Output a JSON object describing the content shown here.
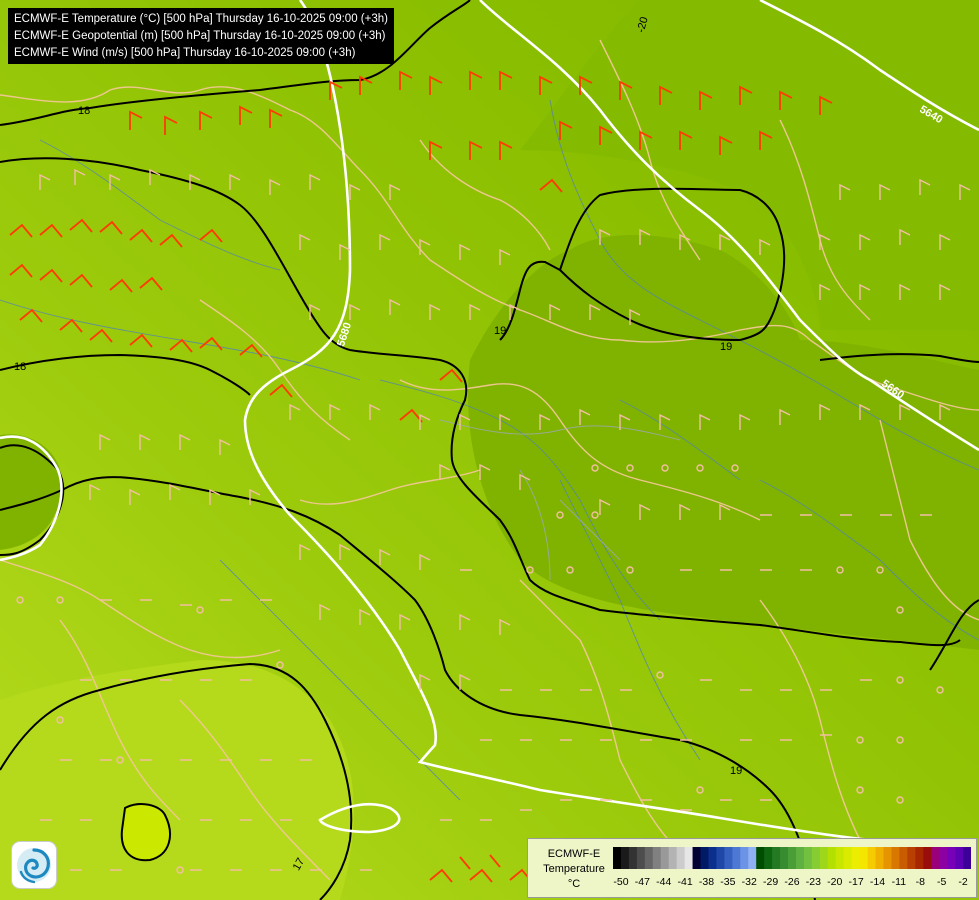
{
  "titles": [
    "ECMWF-E Temperature (°C) [500 hPa] Thursday 16-10-2025 09:00 (+3h)",
    "ECMWF-E Geopotential (m) [500 hPa] Thursday 16-10-2025 09:00 (+3h)",
    "ECMWF-E Wind (m/s) [500 hPa] Thursday 16-10-2025 09:00 (+3h)"
  ],
  "contour_labels": {
    "temp_18_a": "18",
    "temp_18_b": "18",
    "temp_19_a": "19",
    "temp_19_b": "19",
    "temp_19_c": "19",
    "temp_20": "-20",
    "temp_18_c": "18",
    "temp_17": "17",
    "geo_5640": "5640",
    "geo_5660": "5660",
    "geo_5680": "5680"
  },
  "legend": {
    "line1": "ECMWF-E",
    "line2": "Temperature",
    "line3": "°C",
    "ticks": [
      "-50",
      "-47",
      "-44",
      "-41",
      "-38",
      "-35",
      "-32",
      "-29",
      "-26",
      "-23",
      "-20",
      "-17",
      "-14",
      "-11",
      "-8",
      "-5",
      "-2"
    ],
    "colors": [
      "#000000",
      "#1a1a1a",
      "#333333",
      "#4d4d4d",
      "#666666",
      "#808080",
      "#999999",
      "#b3b3b3",
      "#cccccc",
      "#e6e6e6",
      "#000033",
      "#001a66",
      "#0a2f8c",
      "#1f47a8",
      "#3560bf",
      "#4d79d4",
      "#6b93e6",
      "#8fb0f2",
      "#004d00",
      "#0f6611",
      "#237a23",
      "#368c2e",
      "#4a9e38",
      "#5eb040",
      "#72c040",
      "#86cc33",
      "#9dd61a",
      "#b3e000",
      "#c9e600",
      "#dbeb00",
      "#ebee00",
      "#f5e600",
      "#f5cc00",
      "#f0b000",
      "#e69400",
      "#d97800",
      "#c95c00",
      "#b84000",
      "#a82600",
      "#990d0d",
      "#99007a",
      "#8c00a3",
      "#7700b8",
      "#5e00b3",
      "#3d0099"
    ],
    "bg": "#eef6c8"
  },
  "colors": {
    "field_base": "#8dc000",
    "field_dark": "#7db300",
    "field_light": "#a6d21a",
    "field_lighter": "#b8dc1e",
    "pale_zone": "#c9e600",
    "isotherm": "#000000",
    "geopotential": "#ffffff",
    "wind_strong": "#ff3300",
    "wind_weak": "#f0c0a0",
    "borders": "#e8c090",
    "rivers": "#5080c0"
  },
  "logo_icon": "ecmwf-swirl-icon"
}
